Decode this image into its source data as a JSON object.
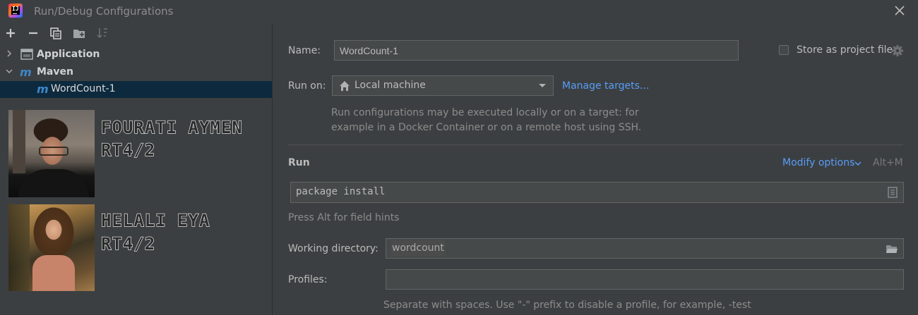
{
  "window": {
    "title": "Run/Debug Configurations"
  },
  "toolbar": {
    "add": "add-icon",
    "remove": "remove-icon",
    "copy": "copy-icon",
    "new_folder": "new-folder-icon",
    "sort": "sort-icon"
  },
  "tree": {
    "items": [
      {
        "label": "Application",
        "level": 0,
        "expanded": false
      },
      {
        "label": "Maven",
        "level": 0,
        "expanded": true
      },
      {
        "label": "WordCount-1",
        "level": 1,
        "selected": true
      }
    ]
  },
  "cards": [
    {
      "name_line": "Fourati Aymen",
      "class_line": "RT4/2"
    },
    {
      "name_line": "Helali Eya",
      "class_line": "RT4/2"
    }
  ],
  "form": {
    "name_label": "Name:",
    "name_value": "WordCount-1",
    "store_label": "Store as project file",
    "store_checked": false,
    "run_on_label": "Run on:",
    "run_on_value": "Local machine",
    "manage_targets": "Manage targets...",
    "run_on_hint_1": "Run configurations may be executed locally or on a target: for",
    "run_on_hint_2": "example in a Docker Container or on a remote host using SSH.",
    "run_section": "Run",
    "modify_options": "Modify options",
    "modify_shortcut": "Alt+M",
    "command_value": "package install",
    "field_hint": "Press Alt for field hints",
    "working_dir_label": "Working directory:",
    "working_dir_value": "wordcount",
    "profiles_label": "Profiles:",
    "profiles_value": "",
    "profiles_hint": "Separate with spaces. Use \"-\" prefix to disable a profile, for example, -test"
  },
  "colors": {
    "background": "#3c3f41",
    "accent_link": "#589df6",
    "selection": "#0d293e",
    "maven_icon": "#3e86c8"
  }
}
